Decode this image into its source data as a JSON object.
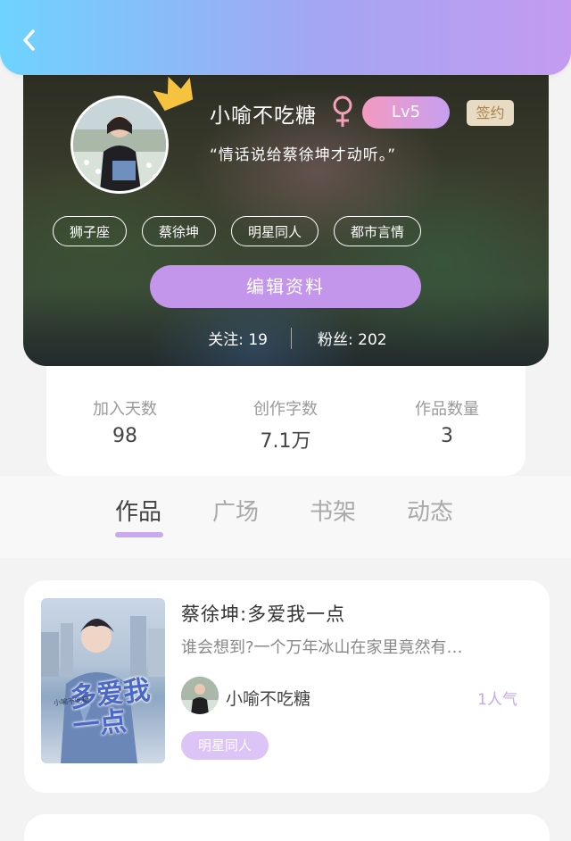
{
  "profile": {
    "nickname": "小喻不吃糖",
    "level": "Lv5",
    "signed_badge": "签约",
    "motto": "“情话说给蔡徐坤才动听。”",
    "tags": [
      "狮子座",
      "蔡徐坤",
      "明星同人",
      "都市言情"
    ],
    "edit_button": "编辑资料",
    "follow_label": "关注:",
    "follow_count": "19",
    "fans_label": "粉丝:",
    "fans_count": "202"
  },
  "stats": [
    {
      "label": "加入天数",
      "value": "98"
    },
    {
      "label": "创作字数",
      "value": "7.1万"
    },
    {
      "label": "作品数量",
      "value": "3"
    }
  ],
  "tabs": [
    {
      "label": "作品",
      "active": true
    },
    {
      "label": "广场",
      "active": false
    },
    {
      "label": "书架",
      "active": false
    },
    {
      "label": "动态",
      "active": false
    }
  ],
  "work": {
    "title": "蔡徐坤:多爱我一点",
    "summary": "谁会想到?一个万年冰山在家里竟然有…",
    "author": "小喻不吃糖",
    "popularity": "1人气",
    "tag": "明星同人",
    "cover_text": "多爱我一点",
    "cover_small_text": "小喻不吃糖"
  },
  "icons": {
    "back": "chevron-left-icon",
    "crown": "crown-icon",
    "gender": "female-icon"
  },
  "colors": {
    "header_start": "#6ed3ff",
    "header_end": "#c49bf0",
    "accent": "#c396ec",
    "signed_bg": "#e8dbc3",
    "signed_text": "#a8824a"
  }
}
